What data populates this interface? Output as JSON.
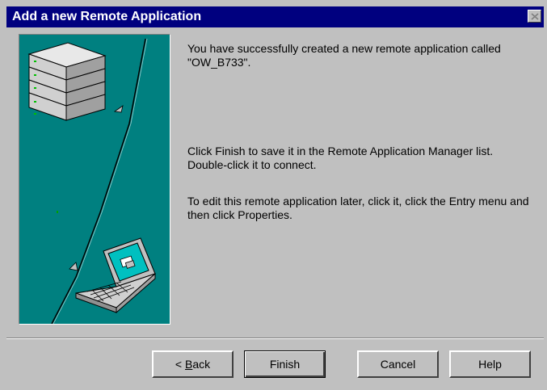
{
  "window": {
    "title": "Add a new Remote Application"
  },
  "messages": {
    "created": "You have successfully created a new remote application called  \"OW_B733\".",
    "finish_hint": "Click Finish to save it in the Remote Application Manager list.  Double-click it to connect.",
    "edit_hint": "To edit this remote application later, click it, click the Entry menu and then click Properties."
  },
  "buttons": {
    "back_prefix": "< ",
    "back_mnemonic": "B",
    "back_rest": "ack",
    "finish": "Finish",
    "cancel": "Cancel",
    "help": "Help"
  },
  "colors": {
    "titlebar": "#00007f",
    "illustration_bg": "#008080",
    "face": "#c0c0c0"
  },
  "icons": {
    "close": "close-icon",
    "server": "server-stack-icon",
    "laptop": "laptop-icon"
  }
}
